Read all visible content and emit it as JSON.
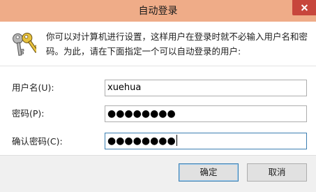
{
  "dialog": {
    "title": "自动登录",
    "description_line1": "你可以对计算机进行设置，这样用户在登录时就不必输入用户名和密",
    "description_line2": "码。为此，请在下面指定一个可以自动登录的用户:"
  },
  "fields": {
    "username_label": "用户名(U):",
    "username_value": "xuehua",
    "password_label": "密码(P):",
    "password_value": "●●●●●●●●",
    "confirm_label": "确认密码(C):",
    "confirm_value": "●●●●●●●●"
  },
  "buttons": {
    "ok_label": "确定",
    "cancel_label": "取消"
  },
  "icons": {
    "keys": "keys-icon",
    "close": "close-icon"
  },
  "colors": {
    "titlebar": "#efac88",
    "close_button": "#c7463c",
    "focus_border": "#3c7fb1"
  }
}
